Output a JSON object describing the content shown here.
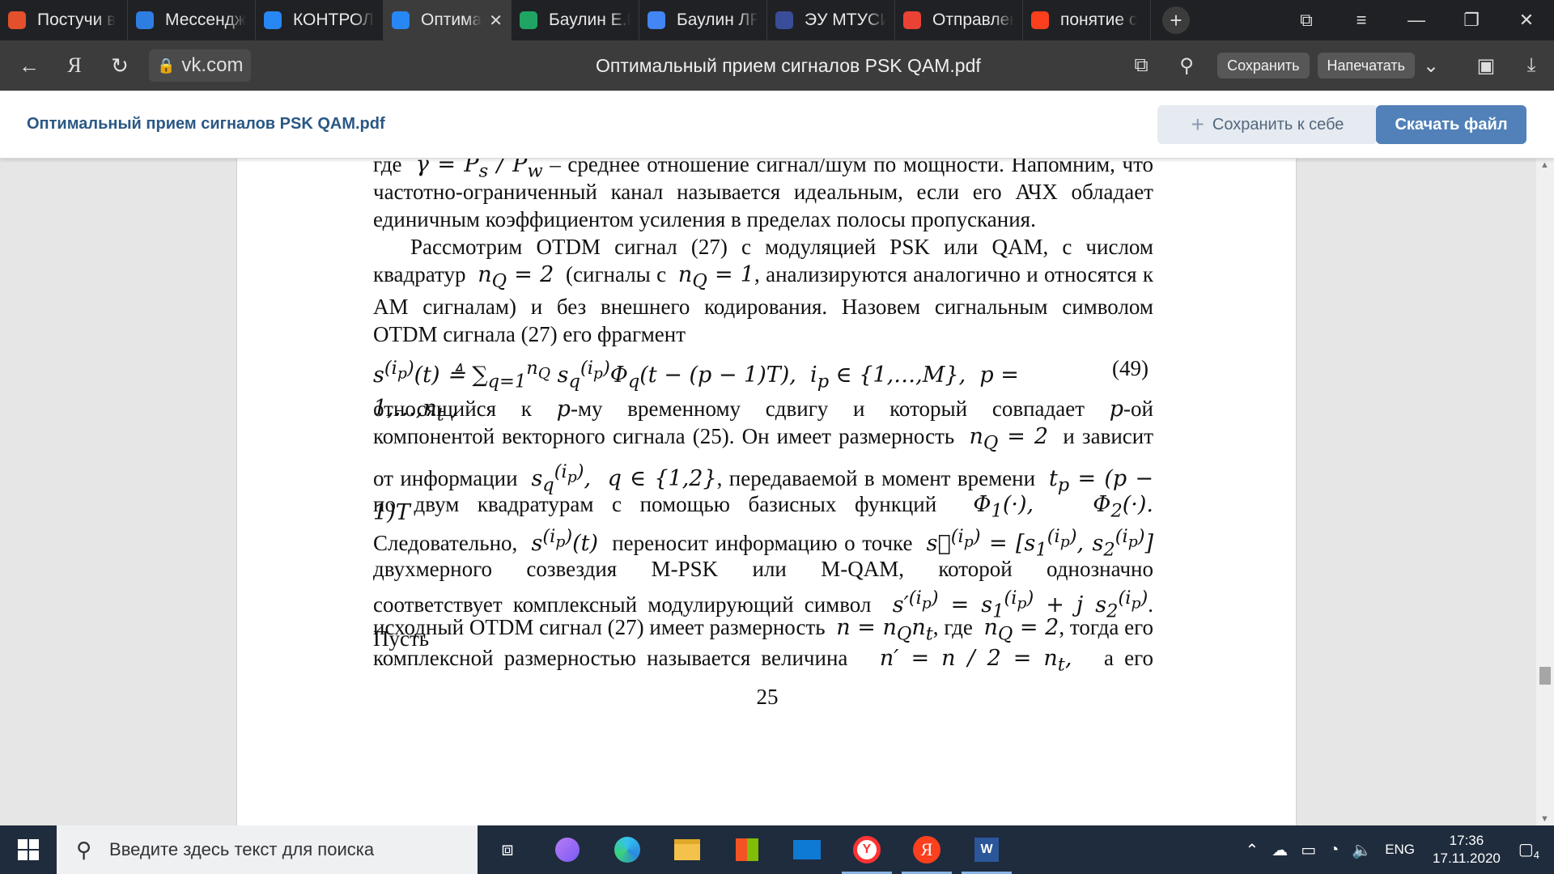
{
  "browser": {
    "tabs": [
      {
        "label": "Постучи в",
        "icon": "star-orange-icon",
        "color": "#e2512c"
      },
      {
        "label": "Мессендж",
        "icon": "messenger-icon",
        "color": "#2e7de1"
      },
      {
        "label": "КОНТРОЛЬ",
        "icon": "vk-icon",
        "color": "#2787f5"
      },
      {
        "label": "Оптима",
        "icon": "vk-icon",
        "color": "#2787f5",
        "active": true
      },
      {
        "label": "Баулин Е.И",
        "icon": "google-drive-icon",
        "color": "#1fa463"
      },
      {
        "label": "Баулин ЛР",
        "icon": "google-docs-icon",
        "color": "#4285f4"
      },
      {
        "label": "ЭУ МТУСИ",
        "icon": "mtuci-icon",
        "color": "#3a4d9a"
      },
      {
        "label": "Отправлен",
        "icon": "gmail-icon",
        "color": "#ea4335"
      },
      {
        "label": "понятие с",
        "icon": "yandex-icon",
        "color": "#fc3f1d"
      }
    ],
    "address": "vk.com",
    "document_title": "Оптимальный прием сигналов PSK QAM.pdf",
    "buttons": {
      "save": "Сохранить",
      "print": "Напечатать"
    }
  },
  "vk": {
    "file_name": "Оптимальный прием сигналов PSK QAM.pdf",
    "save_to_me": "Сохранить к себе",
    "download": "Скачать файл"
  },
  "pdf": {
    "page_number": "25",
    "equation_number": "(49)",
    "p1_l1": "где",
    "p1_l1b": "– среднее отношение сигнал/шум по мощности. Напомним, что",
    "p1_l2": "частотно-ограниченный канал называется идеальным, если его АЧХ обладает",
    "p1_l3": "единичным коэффициентом усиления в пределах полосы пропускания.",
    "p2_l1": "Рассмотрим OTDM сигнал (27) с модуляцией PSK или QAM, с числом",
    "p2_l2a": "квадратур",
    "p2_l2b": "(сигналы с",
    "p2_l2c": ", анализируются аналогично и относятся к",
    "p2_l3": "AM сигналам) и без внешнего кодирования. Назовем сигнальным символом",
    "p2_l4": "OTDM сигнала (27) его фрагмент",
    "p3_l1a": "относящийся к",
    "p3_l1b": "-му временному сдвигу и который совпадает",
    "p3_l1c": "-ой",
    "p3_l2a": "компонентой векторного сигнала (25). Он имеет размерность",
    "p3_l2b": "и зависит",
    "p3_l3a": "от информации",
    "p3_l3b": ", передаваемой в момент времени",
    "p3_l4a": "по двум квадратурам с помощью базисных функций",
    "p3_l5a": "Следовательно,",
    "p3_l5b": "переносит информацию о точке",
    "p3_l6": "двухмерного созвездия M-PSK или M-QAM, которой однозначно",
    "p3_l7a": "соответствует комплексный модулирующий символ",
    "p3_l7b": ". Пусть",
    "p3_l8a": "исходный OTDM сигнал (27) имеет размерность",
    "p3_l8b": ", где",
    "p3_l8c": ", тогда его",
    "p3_l9a": "комплексной размерностью называется величина",
    "p3_l9b": "а его"
  },
  "taskbar": {
    "search_placeholder": "Введите здесь текст для поиска",
    "lang": "ENG",
    "time": "17:36",
    "date": "17.11.2020",
    "notifications": "4"
  }
}
